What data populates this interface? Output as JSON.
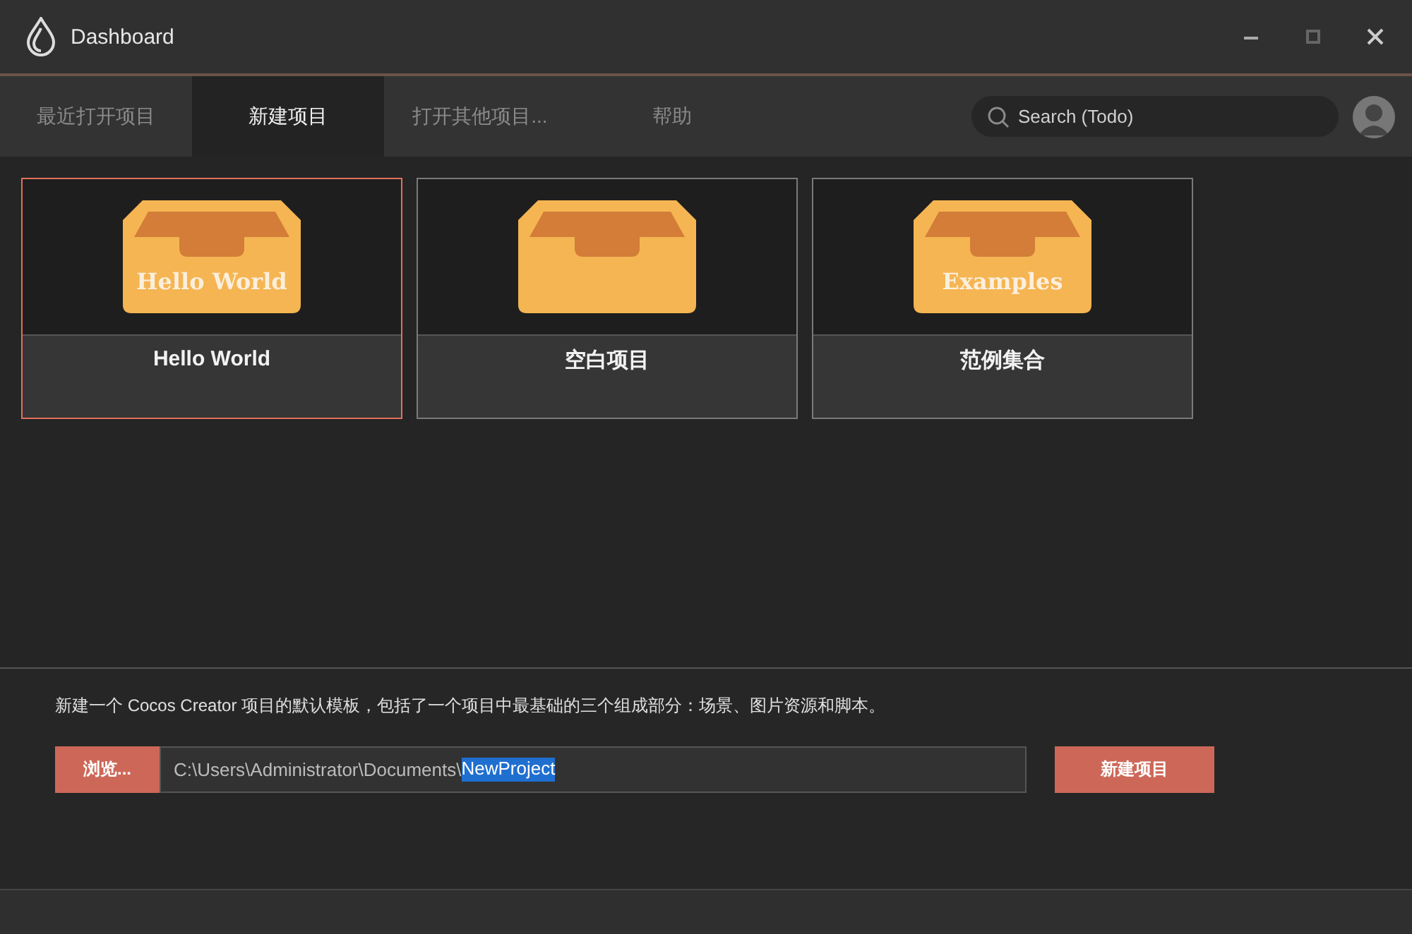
{
  "window": {
    "title": "Dashboard"
  },
  "tabs": [
    {
      "label": "最近打开项目",
      "selected": false
    },
    {
      "label": "新建项目",
      "selected": true
    },
    {
      "label": "打开其他项目...",
      "selected": false
    },
    {
      "label": "帮助",
      "selected": false
    }
  ],
  "search": {
    "placeholder": "Search (Todo)"
  },
  "templates": [
    {
      "name": "Hello World",
      "box_label": "Hello World",
      "selected": true
    },
    {
      "name": "空白项目",
      "selected": false
    },
    {
      "name": "范例集合",
      "box_label": "Examples",
      "selected": false
    }
  ],
  "description": "新建一个 Cocos Creator 项目的默认模板，包括了一个项目中最基础的三个组成部分：场景、图片资源和脚本。",
  "browse_button": "浏览...",
  "path_field": {
    "value": "C:\\Users\\Administrator\\Documents\\",
    "selected_text": "NewProject"
  },
  "create_button": "新建项目"
}
